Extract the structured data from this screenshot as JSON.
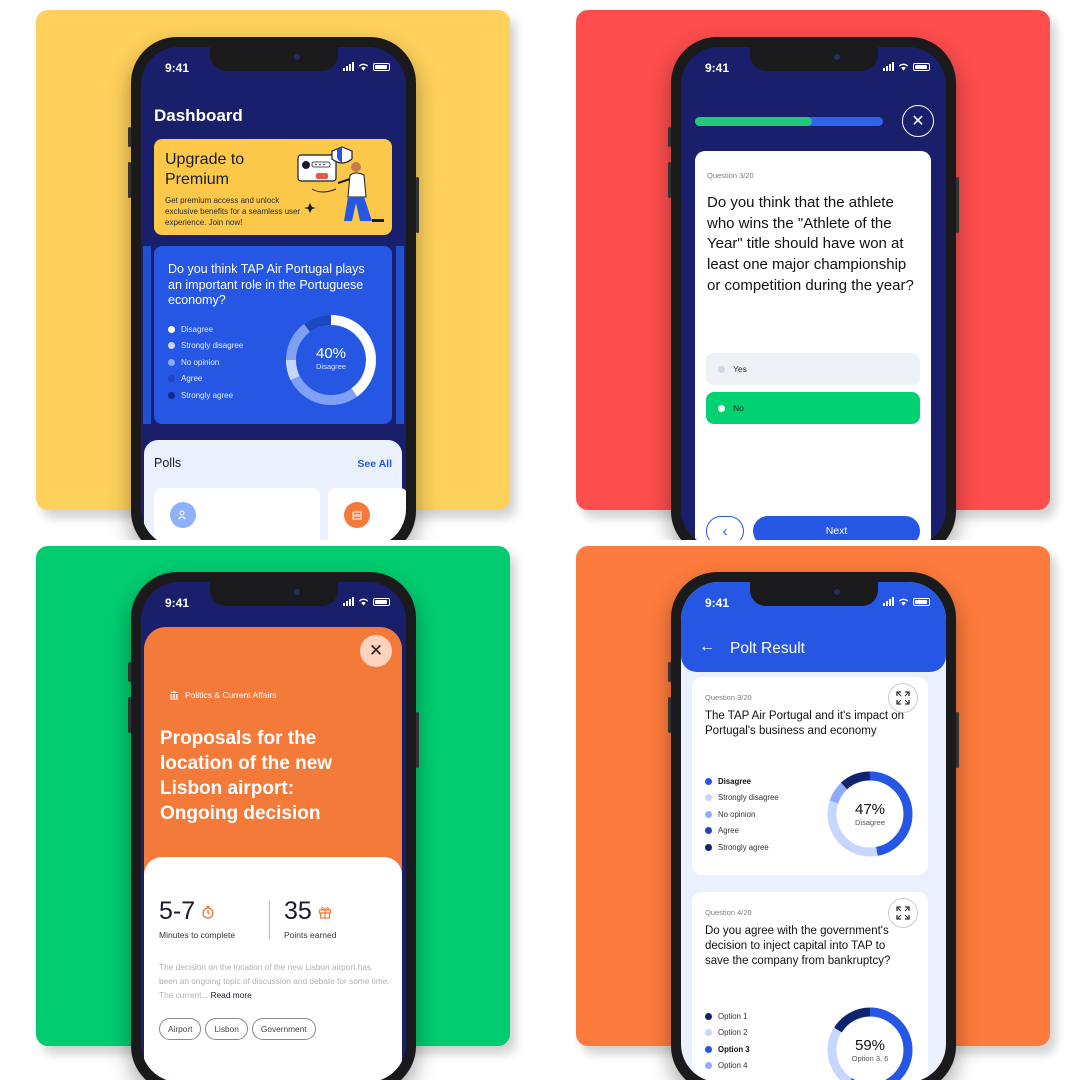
{
  "colors": {
    "yellow_bg": "#fed15c",
    "red_bg": "#fd4d4d",
    "green_bg": "#00cc6f",
    "orange_bg": "#fd7b3c",
    "navy": "#1a1f6b",
    "blue": "#2557e4",
    "green_accent": "#22c97a",
    "orange_panel": "#f47a3a"
  },
  "status_time": "9:41",
  "dashboard": {
    "title": "Dashboard",
    "premium": {
      "title": "Upgrade to Premium",
      "description": "Get premium access and unlock exclusive benefits for a seamless user experience. Join now!"
    },
    "poll": {
      "question": "Do you think TAP Air Portugal plays an important role in the Portuguese economy?",
      "legend": [
        "Disagree",
        "Strongly disagree",
        "No opinion",
        "Agree",
        "Strongly agree"
      ],
      "percent": "40%",
      "percent_label": "Disagree",
      "percent_value": 0.4
    },
    "polls_section": {
      "title": "Polls",
      "see_all": "See All"
    }
  },
  "quiz": {
    "progress": 0.62,
    "question_number": "Question 3/20",
    "question": "Do you think that the athlete who wins the \"Athlete of the Year\" title should have won at least one major championship or competition during the year?",
    "options": [
      "Yes",
      "No"
    ],
    "selected": "No",
    "next_label": "Next",
    "back_icon": "chevron-left-icon",
    "close_icon": "close-icon"
  },
  "article": {
    "category": "Politics & Current Affairs",
    "title": "Proposals for the location of the new Lisbon airport: Ongoing decision",
    "minutes": "5-7",
    "minutes_label": "Minutes to complete",
    "points": "35",
    "points_label": "Points earned",
    "description": "The decision on the location of the new Lisbon airport has been an ongoing topic of discussion and debate for some time. The current...",
    "read_more": "Read more",
    "tags": [
      "Airport",
      "Lisbon",
      "Government"
    ]
  },
  "result": {
    "title": "Polt Result",
    "cards": [
      {
        "question_number": "Question 3/20",
        "question": "The TAP Air Portugal and it's impact on Portugal's business and economy",
        "legend": [
          "Disagree",
          "Strongly disagree",
          "No opinion",
          "Agree",
          "Strongly agree"
        ],
        "bold_items": [
          "Disagree"
        ],
        "percent": "47%",
        "percent_label": "Disagree",
        "percent_value": 0.47
      },
      {
        "question_number": "Question 4/20",
        "question": "Do you agree with the government's decision to inject capital into TAP to save the company from bankruptcy?",
        "legend": [
          "Option 1",
          "Option 2",
          "Option 3",
          "Option 4"
        ],
        "bold_items": [
          "Option 3"
        ],
        "percent": "59%",
        "percent_label": "Option 3, 6",
        "percent_value": 0.59
      }
    ]
  }
}
